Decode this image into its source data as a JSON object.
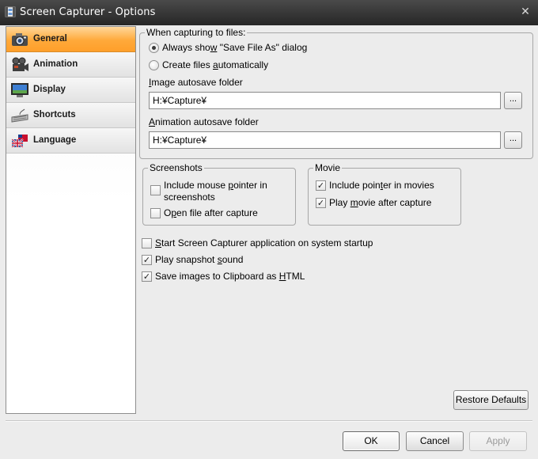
{
  "window": {
    "title": "Screen Capturer - Options",
    "close_glyph": "✕"
  },
  "nav": {
    "items": [
      {
        "label": "General",
        "icon": "camera-icon",
        "active": true
      },
      {
        "label": "Animation",
        "icon": "film-camera-icon",
        "active": false
      },
      {
        "label": "Display",
        "icon": "monitor-icon",
        "active": false
      },
      {
        "label": "Shortcuts",
        "icon": "keyboard-icon",
        "active": false
      },
      {
        "label": "Language",
        "icon": "flag-icon",
        "active": false
      }
    ]
  },
  "capture_files": {
    "legend": "When capturing to files:",
    "radio_always": {
      "pre": "Always sho",
      "u": "w",
      "post": " \"Save File As\" dialog",
      "checked": true
    },
    "radio_auto": {
      "pre": "Create files ",
      "u": "a",
      "post": "utomatically",
      "checked": false
    },
    "image_folder_label": {
      "u": "I",
      "post": "mage autosave folder"
    },
    "image_folder_value": "H:¥Capture¥",
    "anim_folder_label": {
      "u": "A",
      "post": "nimation autosave folder"
    },
    "anim_folder_value": "H:¥Capture¥",
    "browse_label": "..."
  },
  "screenshots": {
    "legend": "Screenshots",
    "include_pointer": {
      "pre": "Include mouse ",
      "u": "p",
      "post": "ointer in",
      "line2": "screenshots",
      "checked": false
    },
    "open_file": {
      "pre": "O",
      "u": "p",
      "post": "en file after capture",
      "checked": false
    }
  },
  "movie": {
    "legend": "Movie",
    "include_pointer": {
      "pre": "Include poin",
      "u": "t",
      "post": "er in movies",
      "checked": true
    },
    "play_movie": {
      "pre": "Play ",
      "u": "m",
      "post": "ovie after capture",
      "checked": true
    }
  },
  "general_options": {
    "startup": {
      "pre": "",
      "u": "S",
      "post": "tart Screen Capturer application on system startup",
      "checked": false
    },
    "sound": {
      "pre": "Play snapshot ",
      "u": "s",
      "post": "ound",
      "checked": true
    },
    "clipboard": {
      "pre": "Save images to Clipboard as ",
      "u": "H",
      "post": "TML",
      "checked": true
    }
  },
  "buttons": {
    "restore": "Restore Defaults",
    "ok": "OK",
    "cancel": "Cancel",
    "apply": "Apply"
  },
  "colors": {
    "title_bar": "#2e2e2e",
    "active_nav": "#ffa93a",
    "window_bg": "#ececec"
  }
}
